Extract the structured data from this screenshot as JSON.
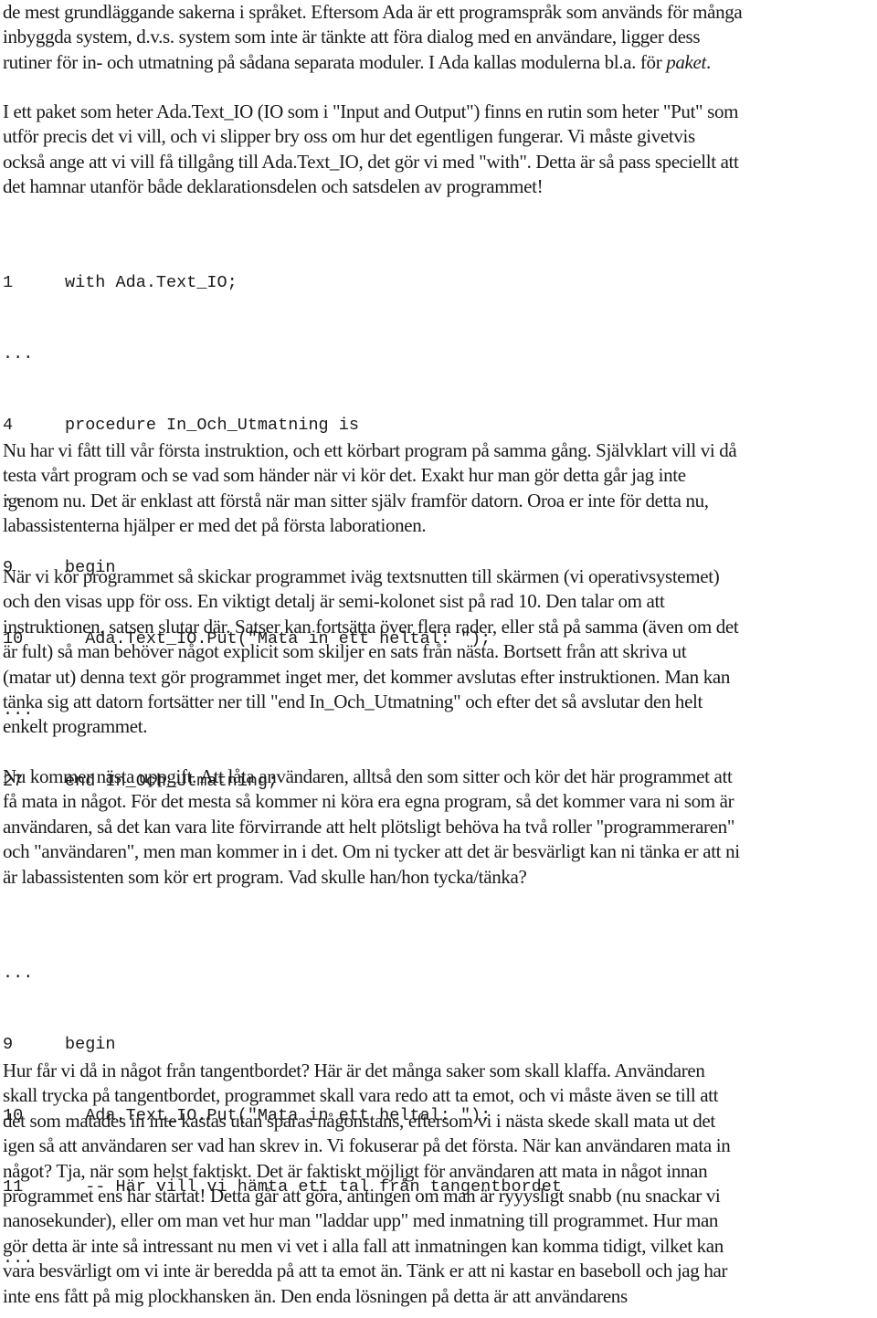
{
  "document": {
    "paragraphs": [
      {
        "lines": [
          "de mest grundläggande sakerna i språket. Eftersom Ada är ett programspråk som används för många",
          "inbyggda system, d.v.s. system som inte är tänkte att föra dialog med en användare, ligger dess",
          "rutiner för in- och utmatning på sådana separata moduler. I Ada kallas modulerna bl.a. för "
        ],
        "italic_term": "paket",
        "italic_suffix": "."
      },
      {
        "lines": [
          "I ett paket som heter Ada.Text_IO (IO som i \"Input and Output\") finns en rutin som heter \"Put\" som",
          "utför precis det vi vill, och vi slipper bry oss om hur det egentligen fungerar. Vi måste givetvis",
          "också ange att vi vill få tillgång till Ada.Text_IO, det gör vi med \"with\". Detta är så pass speciellt att",
          "det hamnar utanför både deklarationsdelen och satsdelen av programmet!"
        ]
      },
      {
        "lines": [
          "Nu har vi fått till vår första instruktion, och ett körbart program på samma gång. Självklart vill vi då",
          "testa vårt program och se vad som händer när vi kör det. Exakt hur man gör detta går jag inte",
          "igenom nu. Det är enklast att förstå när man sitter själv framför datorn. Oroa er inte för detta nu,",
          "labassistenterna hjälper er med det på första laborationen."
        ]
      },
      {
        "lines": [
          "När vi kör programmet så skickar programmet iväg textsnutten till skärmen (vi operativsystemet)",
          "och den visas upp för oss. En viktigt detalj är semi-kolonet sist på rad 10. Den talar om att",
          "instruktionen, satsen slutar där. Satser kan fortsätta över flera rader, eller stå på samma (även om det",
          "är fult) så man behöver något explicit som skiljer en sats från nästa.  Bortsett från att skriva ut",
          "(matar ut) denna text gör programmet inget mer, det kommer avslutas efter instruktionen. Man kan",
          "tänka sig att datorn fortsätter ner till \"end In_Och_Utmatning\" och efter det så avslutar den helt",
          "enkelt programmet."
        ]
      },
      {
        "lines": [
          "Nu kommer nästa uppgift. Att låta användaren, alltså den som sitter och kör det här programmet att",
          "få mata in något. För det mesta så kommer ni köra era egna program, så det kommer vara ni som är",
          "användaren, så det kan vara lite förvirrande att helt plötsligt behöva ha två roller \"programmeraren\"",
          "och \"användaren\", men man kommer in i det. Om ni tycker att det är besvärligt kan ni tänka er att ni",
          "är labassistenten som kör ert program. Vad skulle han/hon tycka/tänka?"
        ]
      },
      {
        "lines": [
          "Hur får vi då in något från tangentbordet? Här är det många saker som skall klaffa. Användaren",
          "skall trycka på tangentbordet, programmet skall vara redo att ta emot, och vi måste även se till att",
          "det som matades in inte kastas utan sparas någonstans, eftersom vi i nästa skede skall mata ut det",
          "igen så att användaren ser vad han skrev in. Vi fokuserar på det första. När kan användaren mata in",
          "något? Tja, när som helst faktiskt. Det är faktiskt möjligt för användaren att mata in något innan",
          "programmet ens har startat! Detta går att göra, antingen om man är ryyysligt snabb (nu snackar vi",
          "nanosekunder), eller om man vet hur man \"laddar upp\" med inmatning till programmet. Hur man",
          "gör detta är inte så intressant nu men vi vet i alla fall att inmatningen kan komma tidigt, vilket kan",
          "vara besvärligt om vi inte är beredda på att ta emot än. Tänk er att ni kastar en baseboll och jag har",
          "inte ens fått på mig plockhansken än. Den enda lösningen på detta är att användarens"
        ]
      }
    ],
    "code_listings": [
      {
        "rows": [
          {
            "num": "1",
            "src": "with Ada.Text_IO;"
          },
          {
            "num": "...",
            "src": ""
          },
          {
            "num": "4",
            "src": "procedure In_Och_Utmatning is"
          },
          {
            "num": "...",
            "src": ""
          },
          {
            "num": "9",
            "src": "begin"
          },
          {
            "num": "10",
            "src": "  Ada.Text_IO.Put(\"Mata in ett heltal: \");"
          },
          {
            "num": "...",
            "src": ""
          },
          {
            "num": "27",
            "src": "end In_Och_Utmatning;"
          }
        ]
      },
      {
        "rows": [
          {
            "num": "...",
            "src": ""
          },
          {
            "num": "9",
            "src": "begin"
          },
          {
            "num": "10",
            "src": "  Ada.Text_IO.Put(\"Mata in ett heltal: \");"
          },
          {
            "num": "11",
            "src": "  -- Här vill vi hämta ett tal från tangentbordet"
          },
          {
            "num": "...",
            "src": ""
          }
        ]
      }
    ]
  }
}
